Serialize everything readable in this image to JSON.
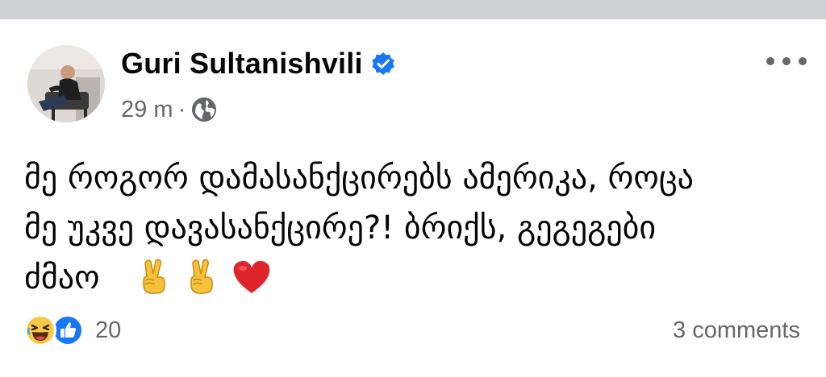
{
  "post": {
    "author": "Guri Sultanishvili",
    "verified_icon": "verified-badge-icon",
    "timestamp": "29 m",
    "separator": "·",
    "audience_icon": "globe-icon",
    "more_icon": "more-options-icon",
    "text_lines": [
      "მე როგორ დამასანქცირებს ამერიკა, როცა",
      "მე უკვე დავასანქცირე?! ბრიქს, გეგეგები",
      "ძმაო"
    ],
    "emojis": [
      "victory-hand-emoji",
      "victory-hand-emoji",
      "red-heart-emoji"
    ]
  },
  "footer": {
    "reaction_icons": [
      "haha-reaction-icon",
      "like-reaction-icon"
    ],
    "reaction_count": "20",
    "comments": "3 comments"
  },
  "colors": {
    "verified_blue": "#1877f2",
    "secondary_text": "#65676b",
    "top_strip": "#cfd1d5",
    "heart_red": "#e0242c",
    "emoji_yellow": "#f5c33b"
  }
}
